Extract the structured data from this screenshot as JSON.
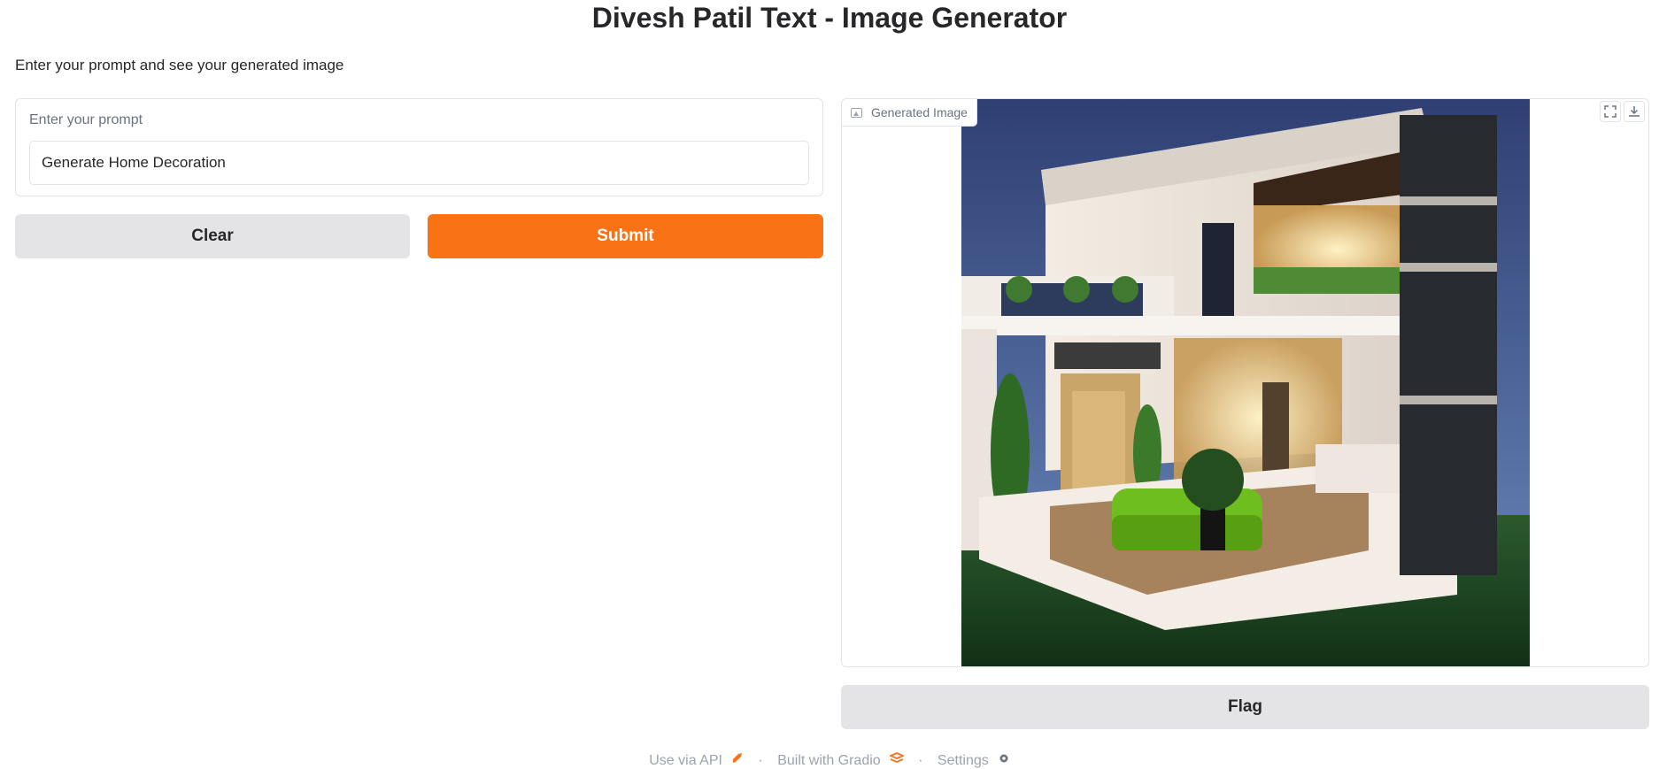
{
  "app": {
    "title": "Divesh Patil Text - Image Generator",
    "description": "Enter your prompt and see your generated image"
  },
  "prompt": {
    "label": "Enter your prompt",
    "value": "Generate Home Decoration"
  },
  "buttons": {
    "clear": "Clear",
    "submit": "Submit",
    "flag": "Flag"
  },
  "output": {
    "label": "Generated Image",
    "tools": [
      "fullscreen-icon",
      "download-icon"
    ]
  },
  "footer": {
    "api": "Use via API",
    "built": "Built with Gradio",
    "settings": "Settings",
    "separator": "·"
  },
  "colors": {
    "accent": "#f97316",
    "secondary": "#e4e4e7"
  }
}
